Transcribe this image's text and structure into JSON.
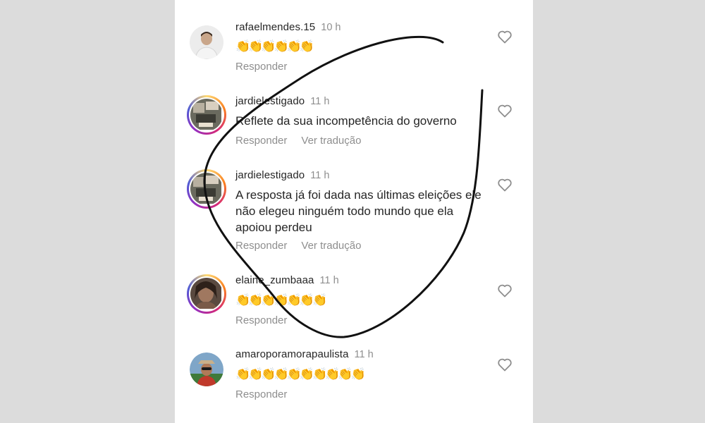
{
  "comments": [
    {
      "username": "rafaelmendes.15",
      "time": "10 h",
      "text": "👏👏👏👏👏👏",
      "reply_label": "Responder",
      "translate_label": ""
    },
    {
      "username": "jardielestigado",
      "time": "11 h",
      "text": "Reflete da sua incompetência do governo",
      "reply_label": "Responder",
      "translate_label": "Ver tradução"
    },
    {
      "username": "jardielestigado",
      "time": "11 h",
      "text": "A resposta já foi dada nas últimas eleições ele não elegeu ninguém todo mundo que ela apoiou perdeu",
      "reply_label": "Responder",
      "translate_label": "Ver tradução"
    },
    {
      "username": "elaine_zumbaaa",
      "time": "11 h",
      "text": "👏👏👏👏👏👏👏",
      "reply_label": "Responder",
      "translate_label": ""
    },
    {
      "username": "amaroporamorapaulista",
      "time": "11 h",
      "text": "👏👏👏👏👏👏👏👏👏👏",
      "reply_label": "Responder",
      "translate_label": ""
    }
  ],
  "icons": {
    "like": "heart-outline-icon"
  },
  "colors": {
    "username": "#262626",
    "secondary": "#8e8e8e",
    "background": "#dcdcdc",
    "ink": "#111111"
  }
}
